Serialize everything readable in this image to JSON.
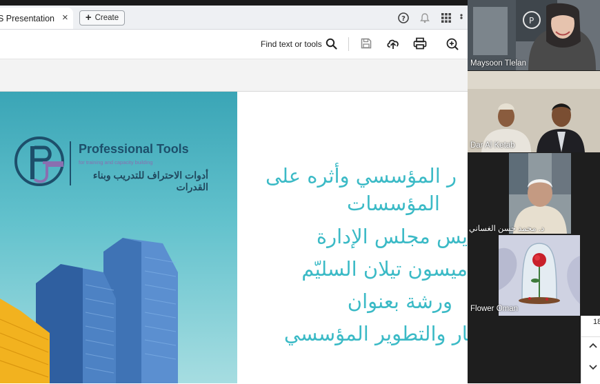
{
  "tabs": {
    "active_title": "S Presentation",
    "close": "×",
    "create_label": "Create"
  },
  "toolbar": {
    "find_label": "Find text or tools"
  },
  "logo": {
    "title_en": "Professional Tools",
    "subtitle_en": "for training and capacity building",
    "title_ar": "أدوات الاحتراف للتدريب وبناء القدرات"
  },
  "slide_text": {
    "line1": "ر المؤسسي وأثره على",
    "line2": "المؤسسات",
    "line3": "يس مجلس الإدارة",
    "line4": "ميسون تيلان السليّم",
    "line5": "ورشة بعنوان",
    "line6": "الابتكار والتطوير المؤسسي"
  },
  "participants": [
    {
      "name": "Maysoon Tlelan"
    },
    {
      "name": "Dar Al Ketab"
    },
    {
      "name": "د. محمد حسن الغساني"
    },
    {
      "name": "Flower Oman"
    }
  ],
  "scroll": {
    "page_number": "18"
  },
  "colors": {
    "accent_text": "#3bbac6",
    "slide_bg": "#3aa5b6",
    "logo_navy": "#1d4f6b"
  }
}
